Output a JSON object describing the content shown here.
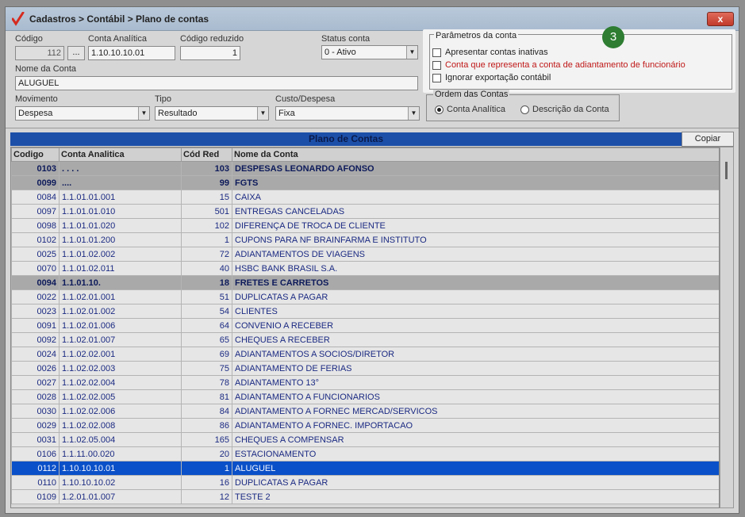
{
  "window": {
    "title": "Cadastros > Contábil > Plano de contas",
    "close_label": "x"
  },
  "form": {
    "codigo_label": "Código",
    "codigo_value": "112",
    "lookup_label": "...",
    "conta_analitica_label": "Conta Analítica",
    "conta_analitica_value": "1.10.10.10.01",
    "codigo_reduzido_label": "Código reduzido",
    "codigo_reduzido_value": "1",
    "status_label": "Status conta",
    "status_value": "0 - Ativo",
    "nome_label": "Nome da Conta",
    "nome_value": "ALUGUEL",
    "movimento_label": "Movimento",
    "movimento_value": "Despesa",
    "tipo_label": "Tipo",
    "tipo_value": "Resultado",
    "custo_label": "Custo/Despesa",
    "custo_value": "Fixa"
  },
  "params": {
    "title": "Parâmetros da conta",
    "badge": "3",
    "options": [
      {
        "label": "Apresentar contas inativas",
        "checked": false
      },
      {
        "label": "Conta que representa a conta de adiantamento de funcionário",
        "checked": false
      },
      {
        "label": "Ignorar exportação contábil",
        "checked": false
      }
    ]
  },
  "order": {
    "title": "Ordem das Contas",
    "option1": "Conta Analítica",
    "option2": "Descrição da Conta",
    "selected": "Conta Analítica"
  },
  "grid": {
    "title": "Plano de Contas",
    "copy_label": "Copiar",
    "columns": [
      "Codigo",
      "Conta Analitica",
      "Cód Red",
      "Nome da Conta"
    ],
    "rows": [
      {
        "codigo": "0103",
        "conta": ". . . .",
        "red": "103",
        "nome": "DESPESAS LEONARDO AFONSO",
        "type": "group"
      },
      {
        "codigo": "0099",
        "conta": "....",
        "red": "99",
        "nome": "FGTS",
        "type": "group"
      },
      {
        "codigo": "0084",
        "conta": "1.1.01.01.001",
        "red": "15",
        "nome": "CAIXA",
        "type": "normal"
      },
      {
        "codigo": "0097",
        "conta": "1.1.01.01.010",
        "red": "501",
        "nome": "ENTREGAS CANCELADAS",
        "type": "normal"
      },
      {
        "codigo": "0098",
        "conta": "1.1.01.01.020",
        "red": "102",
        "nome": "DIFERENÇA DE TROCA DE CLIENTE",
        "type": "normal"
      },
      {
        "codigo": "0102",
        "conta": "1.1.01.01.200",
        "red": "1",
        "nome": "CUPONS PARA NF BRAINFARMA E INSTITUTO",
        "type": "normal"
      },
      {
        "codigo": "0025",
        "conta": "1.1.01.02.002",
        "red": "72",
        "nome": "ADIANTAMENTOS DE VIAGENS",
        "type": "normal"
      },
      {
        "codigo": "0070",
        "conta": "1.1.01.02.011",
        "red": "40",
        "nome": "HSBC BANK BRASIL S.A.",
        "type": "normal"
      },
      {
        "codigo": "0094",
        "conta": "1.1.01.10.",
        "red": "18",
        "nome": "FRETES E CARRETOS",
        "type": "group"
      },
      {
        "codigo": "0022",
        "conta": "1.1.02.01.001",
        "red": "51",
        "nome": "DUPLICATAS A PAGAR",
        "type": "normal"
      },
      {
        "codigo": "0023",
        "conta": "1.1.02.01.002",
        "red": "54",
        "nome": "CLIENTES",
        "type": "normal"
      },
      {
        "codigo": "0091",
        "conta": "1.1.02.01.006",
        "red": "64",
        "nome": "CONVENIO A RECEBER",
        "type": "normal"
      },
      {
        "codigo": "0092",
        "conta": "1.1.02.01.007",
        "red": "65",
        "nome": "CHEQUES A RECEBER",
        "type": "normal"
      },
      {
        "codigo": "0024",
        "conta": "1.1.02.02.001",
        "red": "69",
        "nome": "ADIANTAMENTOS A SOCIOS/DIRETOR",
        "type": "normal"
      },
      {
        "codigo": "0026",
        "conta": "1.1.02.02.003",
        "red": "75",
        "nome": "ADIANTAMENTO DE FERIAS",
        "type": "normal"
      },
      {
        "codigo": "0027",
        "conta": "1.1.02.02.004",
        "red": "78",
        "nome": "ADIANTAMENTO 13°",
        "type": "normal"
      },
      {
        "codigo": "0028",
        "conta": "1.1.02.02.005",
        "red": "81",
        "nome": "ADIANTAMENTO A FUNCIONARIOS",
        "type": "normal"
      },
      {
        "codigo": "0030",
        "conta": "1.1.02.02.006",
        "red": "84",
        "nome": "ADIANTAMENTO A FORNEC MERCAD/SERVICOS",
        "type": "normal"
      },
      {
        "codigo": "0029",
        "conta": "1.1.02.02.008",
        "red": "86",
        "nome": "ADIANTAMENTO A FORNEC. IMPORTACAO",
        "type": "normal"
      },
      {
        "codigo": "0031",
        "conta": "1.1.02.05.004",
        "red": "165",
        "nome": "CHEQUES A COMPENSAR",
        "type": "normal"
      },
      {
        "codigo": "0106",
        "conta": "1.1.11.00.020",
        "red": "20",
        "nome": "ESTACIONAMENTO",
        "type": "normal"
      },
      {
        "codigo": "0112",
        "conta": "1.10.10.10.01",
        "red": "1",
        "nome": "ALUGUEL",
        "type": "selected"
      },
      {
        "codigo": "0110",
        "conta": "1.10.10.10.02",
        "red": "16",
        "nome": "DUPLICATAS A PAGAR",
        "type": "normal"
      },
      {
        "codigo": "0109",
        "conta": "1.2.01.01.007",
        "red": "12",
        "nome": "TESTE 2",
        "type": "normal"
      }
    ]
  }
}
